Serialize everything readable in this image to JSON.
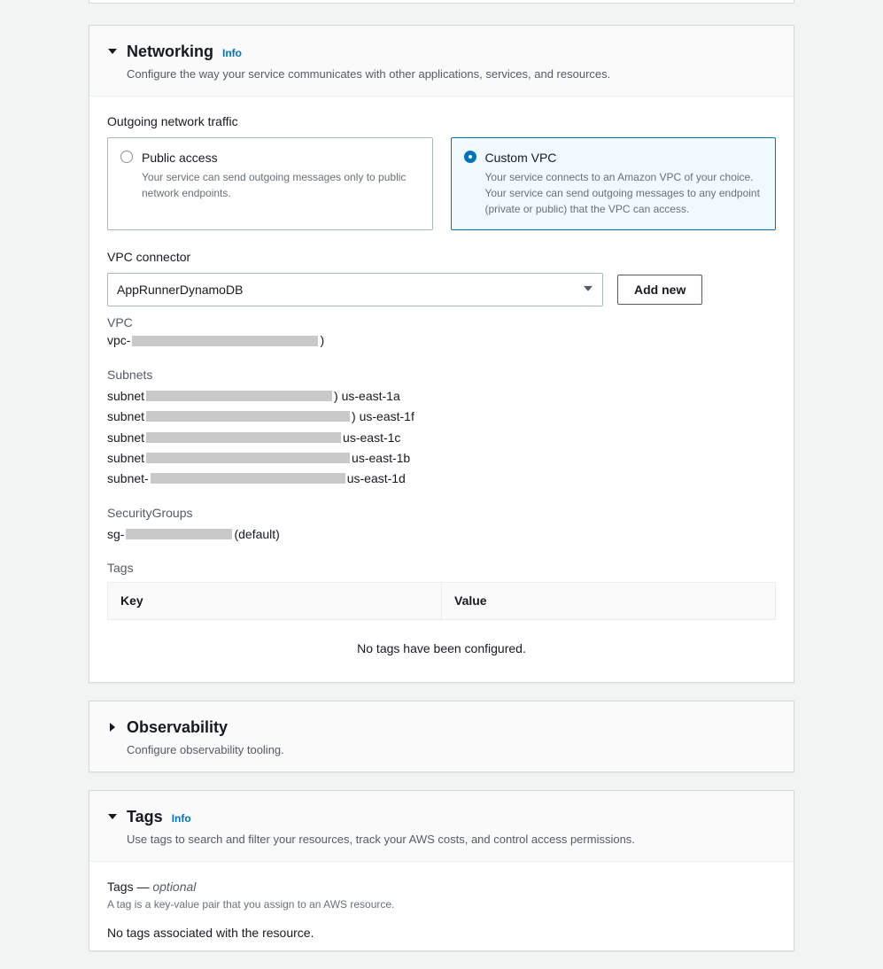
{
  "networking": {
    "title": "Networking",
    "info": "Info",
    "subtitle": "Configure the way your service communicates with other applications, services, and resources.",
    "outgoing_label": "Outgoing network traffic",
    "options": {
      "public": {
        "title": "Public access",
        "desc": "Your service can send outgoing messages only to public network endpoints."
      },
      "custom": {
        "title": "Custom VPC",
        "desc": "Your service connects to an Amazon VPC of your choice. Your service can send outgoing messages to any endpoint (private or public) that the VPC can access."
      }
    },
    "vpc_connector_label": "VPC connector",
    "vpc_connector_value": "AppRunnerDynamoDB",
    "add_new": "Add new",
    "vpc_label": "VPC",
    "vpc_prefix": "vpc-",
    "vpc_suffix": ")",
    "subnets_label": "Subnets",
    "subnets": [
      {
        "prefix": "subnet",
        "suffix": ") us-east-1a",
        "redact_class": "w210"
      },
      {
        "prefix": "subnet",
        "suffix": ") us-east-1f",
        "redact_class": "w230"
      },
      {
        "prefix": "subnet",
        "suffix": " us-east-1c",
        "redact_class": "w220"
      },
      {
        "prefix": "subnet",
        "suffix": " us-east-1b",
        "redact_class": "w230"
      },
      {
        "prefix": "subnet-",
        "suffix": " us-east-1d",
        "redact_class": "w220"
      }
    ],
    "sg_label": "SecurityGroups",
    "sg_prefix": "sg-",
    "sg_suffix": " (default)",
    "tags_label": "Tags",
    "tags_table": {
      "key": "Key",
      "value": "Value"
    },
    "tags_empty": "No tags have been configured."
  },
  "observability": {
    "title": "Observability",
    "subtitle": "Configure observability tooling."
  },
  "tags_panel": {
    "title": "Tags",
    "info": "Info",
    "subtitle": "Use tags to search and filter your resources, track your AWS costs, and control access permissions.",
    "heading_pre": "Tags — ",
    "heading_opt": "optional",
    "desc": "A tag is a key-value pair that you assign to an AWS resource.",
    "empty": "No tags associated with the resource."
  }
}
